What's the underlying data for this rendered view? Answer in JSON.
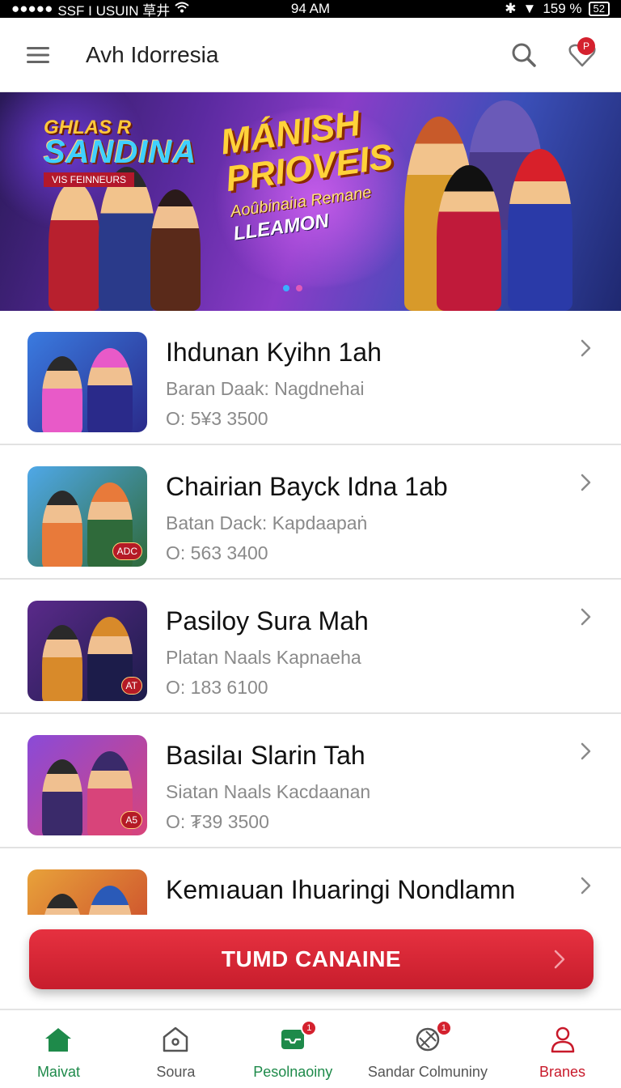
{
  "status_bar": {
    "carrier": "SSF I USUIN 草井",
    "time": "94 AM",
    "battery": "159 %",
    "battery_icon_text": "52"
  },
  "header": {
    "title": "Avh Idorresia",
    "notification_badge": "P"
  },
  "banner": {
    "logo_line1": "GHLAS R",
    "logo_line2": "SANDINA",
    "logo_ribbon": "VIS FEINNEURS",
    "headline_1": "MÁNISH",
    "headline_2": "PRIOVEIS",
    "headline_3": "Aoûbinaiıa Remane",
    "headline_4": "LLEAMON"
  },
  "games": [
    {
      "title": "Ihdunan Kyihn 1ah",
      "subtitle": "Baran Daak: Nagdnehai",
      "meta": "O: 5¥3  3500",
      "tag": "",
      "colors": [
        "#3a7be0",
        "#2a2a8a",
        "#e85ac8"
      ]
    },
    {
      "title": "Chairian Bayck Idna 1ab",
      "subtitle": "Batan Dack: Kapdaapaṅ",
      "meta": "O: 563  3400",
      "tag": "ADC",
      "colors": [
        "#4fa8e8",
        "#2f6a3a",
        "#e87a3a"
      ]
    },
    {
      "title": "Pasiloy Sura Mah",
      "subtitle": "Platan Naals Kapnaeha",
      "meta": "O: 183  6100",
      "tag": "AT",
      "colors": [
        "#5a2a8a",
        "#1c1c4a",
        "#d88a2a"
      ]
    },
    {
      "title": "Basilaı Slarin Tah",
      "subtitle": "Siatan Naals Kacdaanan",
      "meta": "O: ₮39  3500",
      "tag": "A5",
      "colors": [
        "#8a4ad8",
        "#d8447a",
        "#3a2a6a"
      ]
    },
    {
      "title": "Kemıauan Ihuaringi Nondlamn",
      "subtitle": "",
      "meta": "",
      "tag": "",
      "colors": [
        "#e8a23a",
        "#c8402a",
        "#2a5ab8"
      ]
    }
  ],
  "cta": {
    "label": "TUMD CANAINE"
  },
  "bottom_nav": [
    {
      "label": "Maivat",
      "icon": "home-icon",
      "color": "#1e8a4a",
      "badge": ""
    },
    {
      "label": "Soura",
      "icon": "house-outline-icon",
      "color": "#555555",
      "badge": ""
    },
    {
      "label": "Pesolnaoiny",
      "icon": "inbox-icon",
      "color": "#1e8a4a",
      "badge": "1"
    },
    {
      "label": "Sandar Colmuniny",
      "icon": "ball-icon",
      "color": "#555555",
      "badge": "1"
    },
    {
      "label": "Branes",
      "icon": "user-icon",
      "color": "#c8192a",
      "badge": ""
    }
  ],
  "theme": {
    "accent": "#d4212e",
    "green": "#1e8a4a"
  }
}
